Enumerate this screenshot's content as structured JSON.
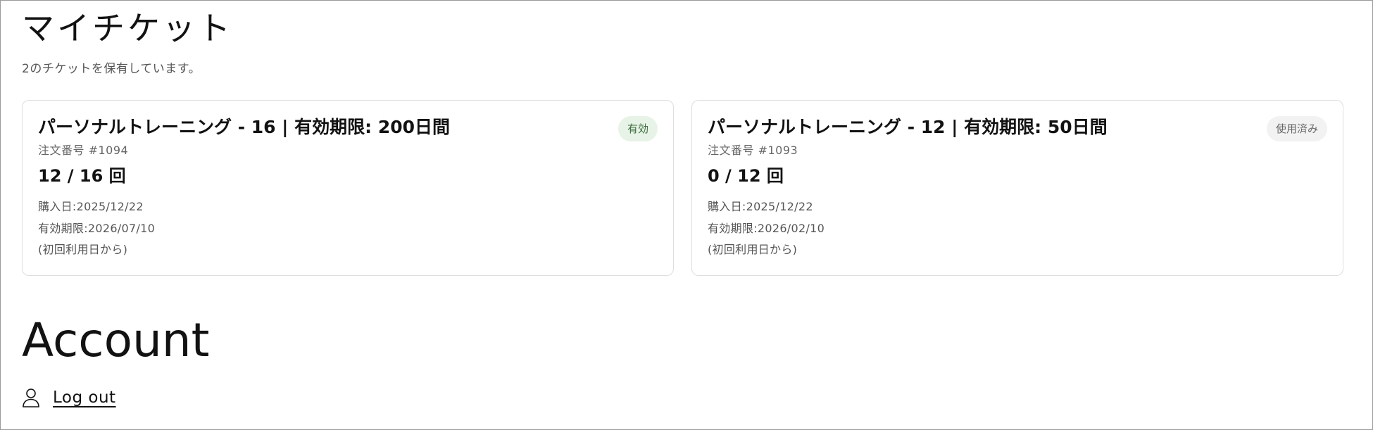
{
  "tickets_section": {
    "title": "マイチケット",
    "summary": "2のチケットを保有しています。"
  },
  "tickets": [
    {
      "name": "パーソナルトレーニング - 16 | 有効期限: 200日間",
      "status": "有効",
      "order_number": "注文番号 #1094",
      "usage": "12 / 16 回",
      "purchase_date": "購入日:2025/12/22",
      "expiry_date": "有効期限:2026/07/10",
      "expiry_note": "(初回利用日から)"
    },
    {
      "name": "パーソナルトレーニング - 12 | 有効期限: 50日間",
      "status": "使用済み",
      "order_number": "注文番号 #1093",
      "usage": "0 / 12 回",
      "purchase_date": "購入日:2025/12/22",
      "expiry_date": "有効期限:2026/02/10",
      "expiry_note": "(初回利用日から)"
    }
  ],
  "account_section": {
    "title": "Account",
    "logout_label": "Log out",
    "logout_icon": "user-icon"
  },
  "colors": {
    "text": "#121212",
    "muted_text": "#555555",
    "card_border": "#dedede",
    "badge_active_bg": "#e7f3e6",
    "badge_active_text": "#3b6b3b",
    "badge_used_bg": "#f2f2f2",
    "badge_used_text": "#666666"
  }
}
